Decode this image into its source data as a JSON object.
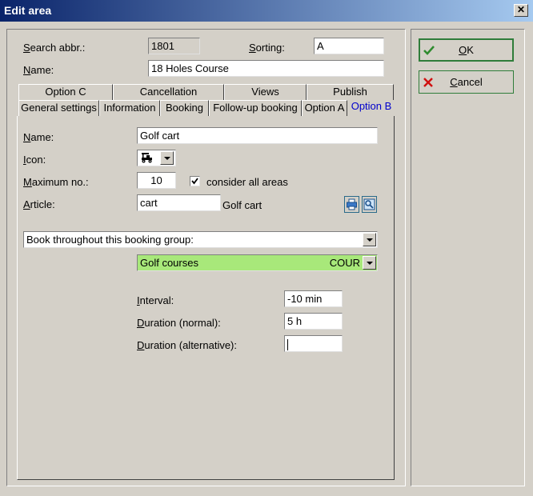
{
  "window": {
    "title": "Edit area",
    "close_glyph": "✕"
  },
  "header": {
    "search_abbr": {
      "label_u": "S",
      "label_rest": "earch abbr.:",
      "value": "1801"
    },
    "sorting": {
      "label_u": "S",
      "label_rest": "orting:",
      "value": "A"
    },
    "name": {
      "label_u": "N",
      "label_rest": "ame:",
      "value": "18 Holes Course"
    }
  },
  "tabs": {
    "row1": [
      "Option C",
      "Cancellation",
      "Views",
      "Publish"
    ],
    "row2": [
      "General settings",
      "Information",
      "Booking",
      "Follow-up booking",
      "Option A"
    ],
    "active": "Option B"
  },
  "form": {
    "name": {
      "label_u": "N",
      "label_rest": "ame:",
      "value": "Golf cart"
    },
    "icon": {
      "label_u": "I",
      "label_rest": "con:",
      "icon_name": "golf-cart-icon"
    },
    "maximum": {
      "label_u": "M",
      "label_rest": "aximum no.:",
      "value": "10"
    },
    "consider_all": {
      "label": "consider all areas",
      "checked": true
    },
    "article": {
      "label_u": "A",
      "label_rest": "rticle:",
      "value": "cart",
      "description": "Golf cart"
    },
    "booking_mode": "Book throughout this booking group:",
    "group": {
      "name": "Golf courses",
      "code": "COUR",
      "color": "#a8e87a"
    },
    "interval": {
      "label_u": "I",
      "label_rest": "nterval:",
      "value": "-10 min"
    },
    "duration_normal": {
      "label_u": "D",
      "label_rest": "uration (normal):",
      "value": "5 h"
    },
    "duration_alt": {
      "label_u": "D",
      "label_rest": "uration (alternative):",
      "value": ""
    }
  },
  "buttons": {
    "ok": {
      "label_u": "O",
      "label_rest": "K"
    },
    "cancel": {
      "label_u": "C",
      "label_rest": "ancel"
    }
  }
}
